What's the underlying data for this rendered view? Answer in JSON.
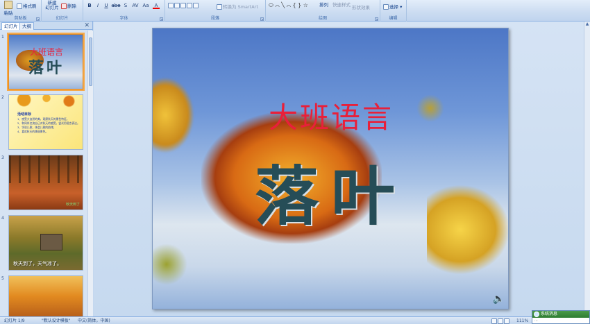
{
  "ribbon": {
    "clipboard": {
      "paste_label": "粘贴",
      "format_painter_label": "格式刷",
      "group_label": "剪贴板"
    },
    "slides": {
      "new_slide_label": "新建\n幻灯片",
      "delete_label": "删除",
      "group_label": "幻灯片"
    },
    "font": {
      "bold": "B",
      "italic": "I",
      "underline": "U",
      "strike": "abe",
      "shadow": "S",
      "spacing": "AV",
      "case": "Aa",
      "color": "A",
      "group_label": "字体"
    },
    "paragraph": {
      "smartart_label": "转换为 SmartArt",
      "group_label": "段落"
    },
    "drawing": {
      "arrange_label": "排列",
      "quick_styles_label": "快速样式",
      "shape_effects_label": "形状效果",
      "group_label": "绘图"
    },
    "editing": {
      "select_label": "选择",
      "group_label": "编辑"
    }
  },
  "left_panel": {
    "tabs": [
      "幻灯片",
      "大纲"
    ],
    "thumbnails": [
      {
        "num": "1",
        "title": "大班语言",
        "subtitle": "落叶"
      },
      {
        "num": "2",
        "heading": "活动目标",
        "lines": [
          "1、感受大自然的美，观察秋天的景色特征。",
          "2、和同伴交流自己对秋天的感受，尝试用语言表达。",
          "3、学说儿歌，体会儿歌的韵律。",
          "4、喜欢秋天的美丽景色。"
        ]
      },
      {
        "num": "3",
        "caption": "秋天到了"
      },
      {
        "num": "4",
        "caption": "秋天到了，天气凉了。"
      },
      {
        "num": "5"
      }
    ]
  },
  "slide": {
    "title": "大班语言",
    "subtitle": "落叶"
  },
  "status": {
    "slide_index": "幻灯片 1/9",
    "template": "\"默认设计模板\"",
    "language": "中文(简体，中国)",
    "zoom": "111%"
  },
  "popup": {
    "title": "系统消息",
    "body": "..."
  },
  "colors": {
    "title_red": "#e8203a",
    "subtitle_teal": "#264d57",
    "ribbon_blue": "#c4d8ef"
  }
}
